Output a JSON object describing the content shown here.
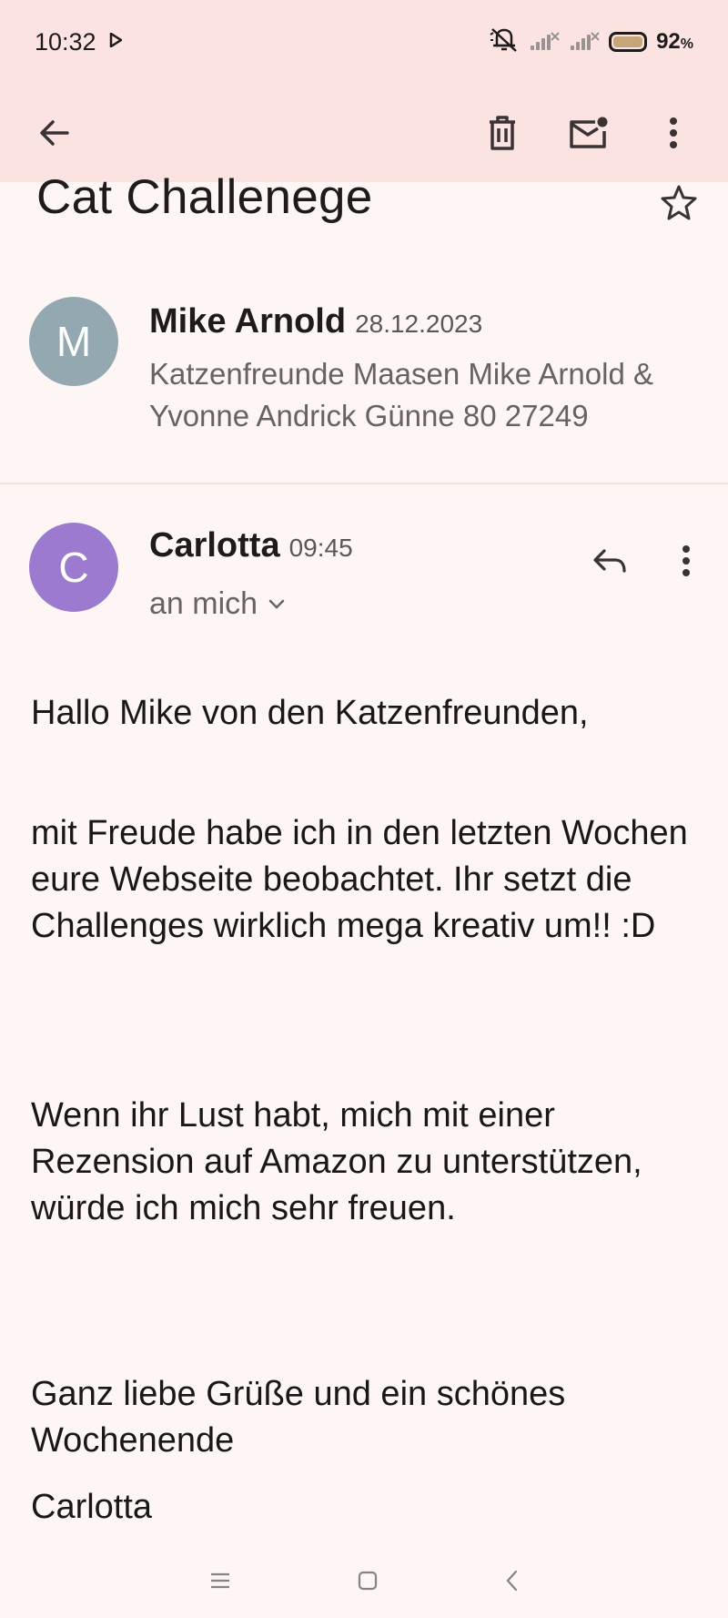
{
  "status": {
    "time": "10:32",
    "battery_pct": "92",
    "battery_unit": "%"
  },
  "icons": {
    "back": "arrow-left-icon",
    "delete": "trash-icon",
    "mark_unread": "mail-unread-icon",
    "more": "more-vert-icon",
    "star": "star-outline-icon",
    "reply": "reply-icon"
  },
  "subject": "Cat Challenege",
  "messages": [
    {
      "avatar_letter": "M",
      "avatar_color": "#93a8b1",
      "sender": "Mike Arnold",
      "date": "28.12.2023",
      "snippet": "Katzenfreunde Maasen Mike Arnold & Yvonne Andrick Günne 80 27249"
    },
    {
      "avatar_letter": "C",
      "avatar_color": "#9c7ad0",
      "sender": "Carlotta",
      "time": "09:45",
      "recipient": "an mich",
      "body": {
        "greeting": "Hallo Mike von den Katzenfreunden,",
        "paragraph1": "mit Freude habe ich in den letzten Wochen eure Webseite beobachtet. Ihr setzt die Challenges wirklich mega kreativ um!! :D",
        "paragraph2": "Wenn ihr Lust habt, mich mit einer Rezension auf Amazon zu unterstützen, würde ich mich sehr freuen.",
        "closing": "Ganz liebe Grüße und ein schönes Wochenende",
        "signature": "Carlotta"
      }
    }
  ]
}
